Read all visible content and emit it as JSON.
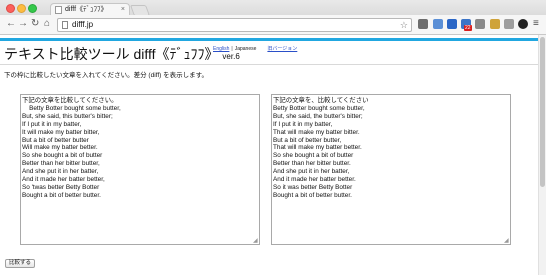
{
  "browser": {
    "tab_title": "difff《ﾃﾞｭﾌﾌ》",
    "tab_close": "×",
    "url": "difff.jp",
    "extension_badge": "22",
    "icons": [
      "back-arrow-icon",
      "forward-arrow-icon",
      "reload-icon",
      "home-icon",
      "page-icon",
      "bookmark-star-icon",
      "menu-icon"
    ]
  },
  "page": {
    "title": "テキスト比較ツール difff《ﾃﾞｭﾌﾌ》",
    "version": "ver.6",
    "lang_english": "English",
    "lang_separator": "|",
    "lang_japanese": "Japanese",
    "old_version": "旧バージョン",
    "instruction": "下の枠に比較したい文章を入れてください。差分 (diff) を表示します。",
    "text_left": "下記の文章を比較してください。\n    Betty Botter bought some butter,\nBut, she said, this butter's bitter;\nIf I put it in my batter,\nIt will make my batter bitter,\nBut a bit of better butter\nWill make my batter better.\nSo she bought a bit of butter\nBetter than her bitter butter,\nAnd she put it in her batter,\nAnd it made her batter better,\nSo 'twas better Betty Botter\nBought a bit of better butter.",
    "text_right": "下記の文章を、比較してください\nBetty Botter bought some butter,\nBut, she said, the butter's bitter;\nIf I put it in my batter,\nThat will make my batter bitter.\nBut a bit of better butter,\nThat will make my batter better.\nSo she bought a bit of butter\nBetter than her bitter butter.\nAnd she put it in her batter,\nAnd it made her batter better.\nSo it was better Betty Botter\nBought a bit of better butter.",
    "submit_label": "比較する"
  },
  "colors": {
    "accent_bar": "#21a7e0",
    "link": "#2a4fc8"
  }
}
